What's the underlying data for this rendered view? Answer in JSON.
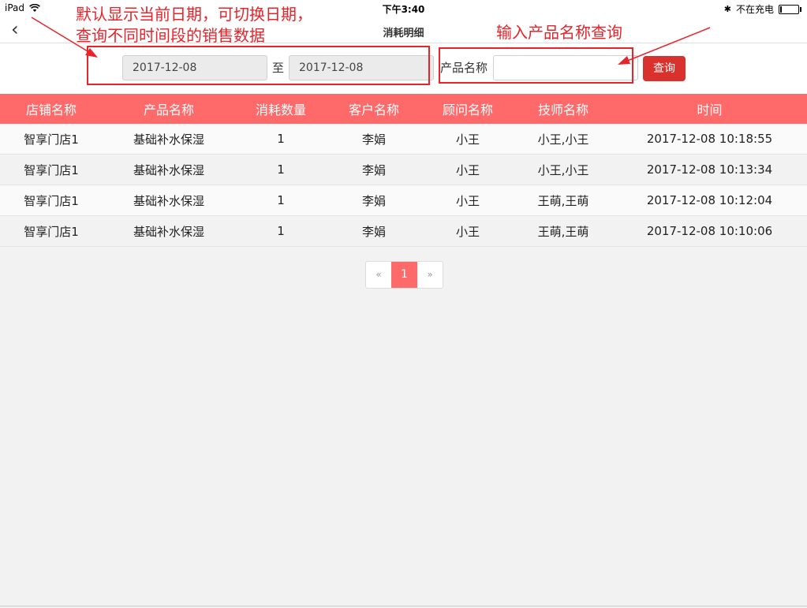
{
  "status_bar": {
    "device": "iPad",
    "time": "下午3:40",
    "charging": "不在充电",
    "battery_level": 0.1
  },
  "nav": {
    "back": "‹",
    "title": "消耗明细"
  },
  "filter": {
    "start_date": "2017-12-08",
    "to_label": "至",
    "end_date": "2017-12-08",
    "product_label": "产品名称",
    "product_value": "",
    "query_label": "查询"
  },
  "annotations": {
    "date_note_line1": "默认显示当前日期，可切换日期，",
    "date_note_line2": "查询不同时间段的销售数据",
    "product_note": "输入产品名称查询"
  },
  "table": {
    "columns": [
      "店铺名称",
      "产品名称",
      "消耗数量",
      "客户名称",
      "顾问名称",
      "技师名称",
      "时间"
    ],
    "rows": [
      [
        "智享门店1",
        "基础补水保湿",
        "1",
        "李娟",
        "小王",
        "小王,小王",
        "2017-12-08 10:18:55"
      ],
      [
        "智享门店1",
        "基础补水保湿",
        "1",
        "李娟",
        "小王",
        "小王,小王",
        "2017-12-08 10:13:34"
      ],
      [
        "智享门店1",
        "基础补水保湿",
        "1",
        "李娟",
        "小王",
        "王萌,王萌",
        "2017-12-08 10:12:04"
      ],
      [
        "智享门店1",
        "基础补水保湿",
        "1",
        "李娟",
        "小王",
        "王萌,王萌",
        "2017-12-08 10:10:06"
      ]
    ]
  },
  "pagination": {
    "prev": "«",
    "current": "1",
    "next": "»"
  },
  "colors": {
    "accent": "#fe6a6a",
    "button": "#d9322e",
    "annotation": "#e8232a"
  }
}
